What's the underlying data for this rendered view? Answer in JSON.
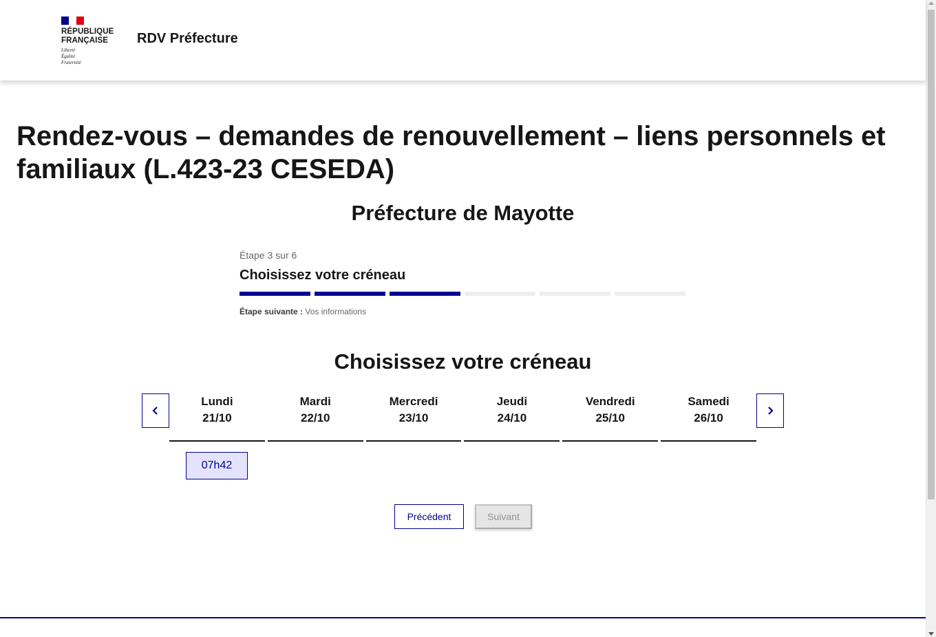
{
  "header": {
    "flag_colors": [
      "#000091",
      "#ffffff",
      "#e1000f"
    ],
    "republic_line1": "RÉPUBLIQUE",
    "republic_line2": "FRANÇAISE",
    "motto_1": "Liberté",
    "motto_2": "Égalité",
    "motto_3": "Fraternité",
    "service_title": "RDV Préfecture"
  },
  "main": {
    "page_title": "Rendez-vous – demandes de renouvellement – liens personnels et familiaux (L.423-23 CESEDA)",
    "prefecture": "Préfecture de Mayotte"
  },
  "stepper": {
    "state": "Étape 3 sur 6",
    "title": "Choisissez votre créneau",
    "current_step": 3,
    "total_steps": 6,
    "next_label": "Étape suivante :",
    "next_value": "Vos informations"
  },
  "calendar": {
    "title": "Choisissez votre créneau",
    "prev_icon": "chevron-left-icon",
    "next_icon": "chevron-right-icon",
    "days": [
      {
        "name": "Lundi",
        "date": "21/10"
      },
      {
        "name": "Mardi",
        "date": "22/10"
      },
      {
        "name": "Mercredi",
        "date": "23/10"
      },
      {
        "name": "Jeudi",
        "date": "24/10"
      },
      {
        "name": "Vendredi",
        "date": "25/10"
      },
      {
        "name": "Samedi",
        "date": "26/10"
      }
    ],
    "slots": [
      {
        "day": "Lundi",
        "time": "07h42"
      }
    ]
  },
  "actions": {
    "previous_label": "Précédent",
    "next_label": "Suivant"
  },
  "colors": {
    "primary": "#000091",
    "slot_bg": "#e3e3fd",
    "disabled_bg": "#e5e5e5",
    "disabled_text": "#929292",
    "step_inactive": "#eeeeee"
  }
}
